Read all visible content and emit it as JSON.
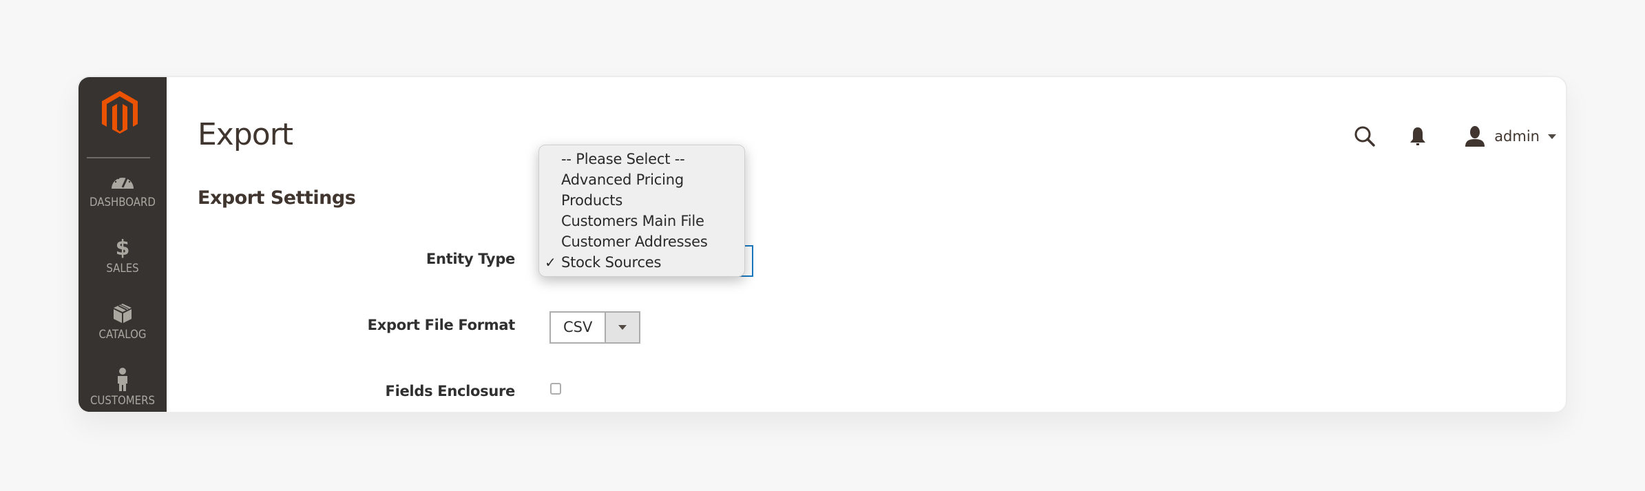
{
  "sidebar": {
    "logo": "magento-logo-icon",
    "items": [
      {
        "label": "DASHBOARD",
        "icon": "speedometer-icon"
      },
      {
        "label": "SALES",
        "icon": "dollar-icon"
      },
      {
        "label": "CATALOG",
        "icon": "box-icon"
      },
      {
        "label": "CUSTOMERS",
        "icon": "person-icon"
      }
    ]
  },
  "header": {
    "title": "Export",
    "user": "admin",
    "icons": [
      "search-icon",
      "bell-icon",
      "user-icon",
      "caret-down-icon"
    ]
  },
  "main": {
    "section_title": "Export Settings",
    "fields": {
      "entity_type": {
        "label": "Entity Type",
        "selected": "Stock Sources",
        "options": [
          "-- Please Select --",
          "Advanced Pricing",
          "Products",
          "Customers Main File",
          "Customer Addresses",
          "Stock Sources"
        ],
        "check_mark": "✓"
      },
      "export_file_format": {
        "label": "Export File Format",
        "value": "CSV"
      },
      "fields_enclosure": {
        "label": "Fields Enclosure",
        "checked": false
      }
    }
  },
  "colors": {
    "brand": "#eb5202",
    "sidebar_bg": "#373330",
    "sidebar_text": "#aaa6a0",
    "focus_border": "#1979c3",
    "page_bg": "#f7f7f7"
  }
}
